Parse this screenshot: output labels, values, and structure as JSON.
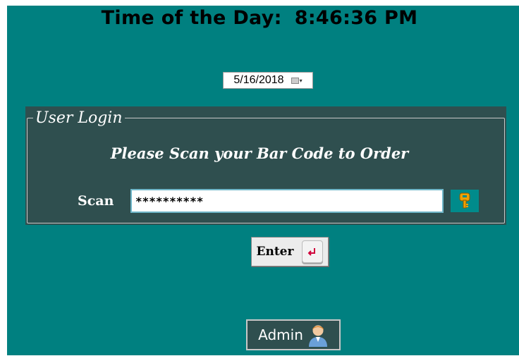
{
  "header": {
    "label": "Time of the Day:",
    "time": "8:46:36 PM"
  },
  "date_picker": {
    "value": "5/16/2018",
    "icon": "calendar-icon"
  },
  "login": {
    "legend": "User Login",
    "instruction": "Please Scan your Bar Code to Order",
    "scan_label": "Scan",
    "scan_value": "**********",
    "key_icon": "key-icon"
  },
  "buttons": {
    "enter_label": "Enter",
    "enter_icon": "enter-key-icon",
    "admin_label": "Admin",
    "admin_icon": "user-icon"
  },
  "colors": {
    "background": "#008080",
    "panel": "#2f4f4f",
    "key_button": "#008b8b",
    "key_icon": "#f0a000",
    "enter_arrow": "#d0003a"
  }
}
